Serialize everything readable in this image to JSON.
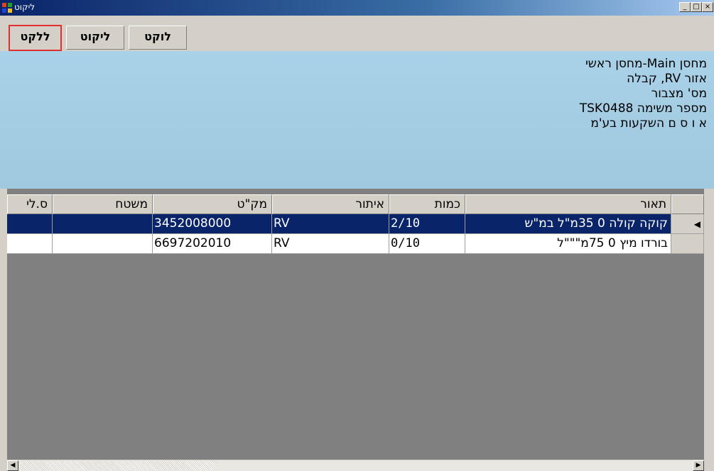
{
  "window": {
    "title": "ליקוט",
    "minimize": "_",
    "maximize": "□",
    "close": "×"
  },
  "tabs": [
    {
      "label": "ללקט"
    },
    {
      "label": "ליקוט"
    },
    {
      "label": "לוקט"
    }
  ],
  "info": {
    "line1": "מחסן Main-מחסן ראשי",
    "line2": "אזור RV, קבלה",
    "line3": "מס' מצבור",
    "line4": "מספר משימה TSK0488",
    "line5": "א ו ס ם השקעות בע'מ"
  },
  "table": {
    "headers": {
      "description": "תאור",
      "quantity": "כמות",
      "location": "איתור",
      "sku": "מק\"ט",
      "pallet": "משטח",
      "batch": "ס.לי"
    },
    "rows": [
      {
        "description": "קוקה קולה 0 35מ\"ל  במ\"ש",
        "quantity": "2/10",
        "location": "RV",
        "sku": "3452008000",
        "pallet": "",
        "batch": ""
      },
      {
        "description": "בורדו מיץ 0 75מ\"\"\"ל",
        "quantity": "0/10",
        "location": "RV",
        "sku": "6697202010",
        "pallet": "",
        "batch": ""
      }
    ]
  },
  "scrollbar": {
    "left_arrow": "◀",
    "right_arrow": "▶"
  }
}
